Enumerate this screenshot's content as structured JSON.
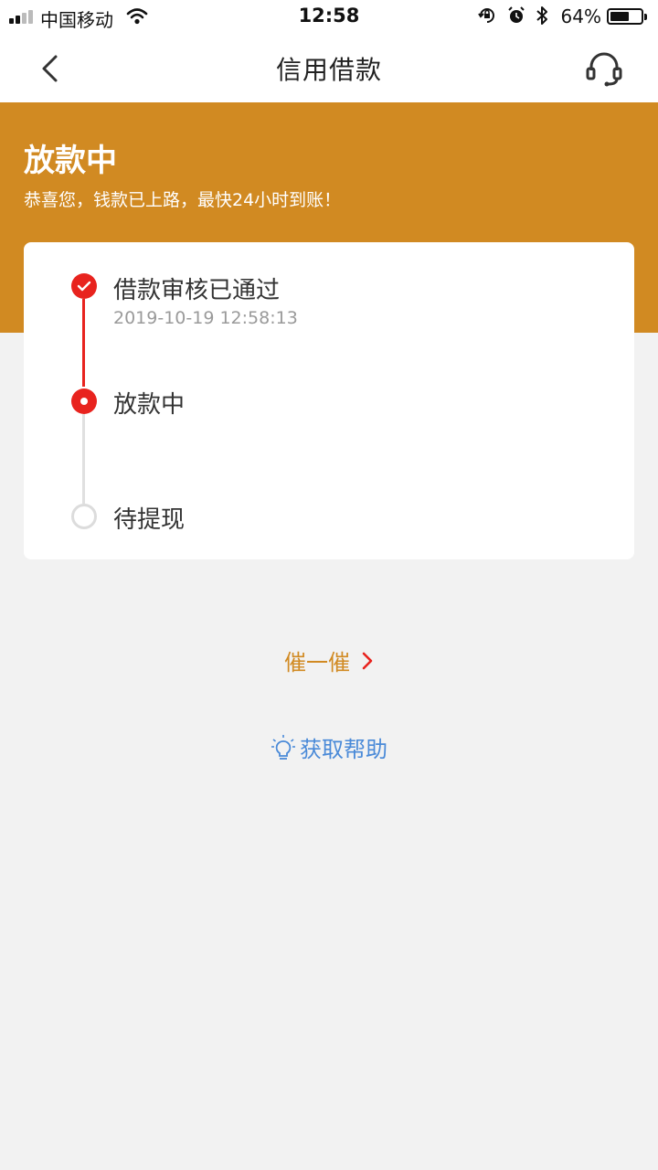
{
  "status_bar": {
    "carrier": "中国移动",
    "time": "12:58",
    "battery": "64%",
    "battery_level": 0.64
  },
  "nav": {
    "title": "信用借款",
    "back_icon": "chevron-left-icon",
    "support_icon": "headset-icon"
  },
  "header": {
    "status": "放款中",
    "message": "恭喜您，钱款已上路，最快24小时到账！",
    "color": "#d18a22"
  },
  "steps": [
    {
      "label": "借款审核已通过",
      "date": "2019-10-19 12:58:13",
      "state": "done"
    },
    {
      "label": "放款中",
      "state": "active"
    },
    {
      "label": "待提现",
      "state": "pending"
    }
  ],
  "actions": {
    "urge_label": "催一催",
    "help_label": "获取帮助"
  },
  "colors": {
    "accent_red": "#e8231e",
    "help_blue": "#4a8ad8",
    "background": "#f2f2f2"
  }
}
